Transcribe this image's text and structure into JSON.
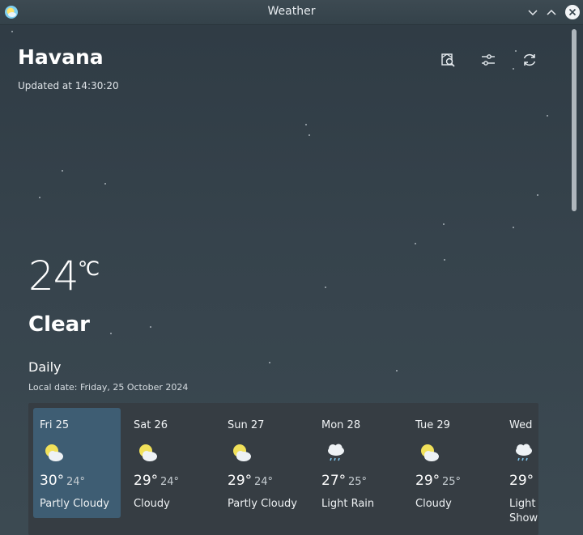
{
  "window": {
    "title": "Weather"
  },
  "location": {
    "city": "Havana",
    "updated": "Updated at 14:30:20"
  },
  "toolbar": {
    "icons": [
      "search-location-icon",
      "settings-sliders-icon",
      "refresh-icon"
    ]
  },
  "current": {
    "temperature": "24",
    "unit": "℃",
    "condition": "Clear"
  },
  "daily": {
    "heading": "Daily",
    "local_date": "Local date: Friday, 25 October 2024",
    "days": [
      {
        "name": "Fri 25",
        "high": "30°",
        "low": "24°",
        "desc": "Partly Cloudy",
        "icon": "partly-cloudy-icon",
        "selected": true
      },
      {
        "name": "Sat 26",
        "high": "29°",
        "low": "24°",
        "desc": "Cloudy",
        "icon": "partly-cloudy-icon",
        "selected": false
      },
      {
        "name": "Sun 27",
        "high": "29°",
        "low": "24°",
        "desc": "Partly Cloudy",
        "icon": "partly-cloudy-icon",
        "selected": false
      },
      {
        "name": "Mon 28",
        "high": "27°",
        "low": "25°",
        "desc": "Light Rain",
        "icon": "rain-cloud-icon",
        "selected": false
      },
      {
        "name": "Tue 29",
        "high": "29°",
        "low": "25°",
        "desc": "Cloudy",
        "icon": "partly-cloudy-icon",
        "selected": false
      },
      {
        "name": "Wed",
        "high": "29°",
        "low": "",
        "desc": "Light Show",
        "icon": "rain-cloud-icon",
        "selected": false
      }
    ]
  },
  "colors": {
    "background": "#36434c",
    "selected_card": "#3e5d73",
    "panel": "#363d43"
  }
}
